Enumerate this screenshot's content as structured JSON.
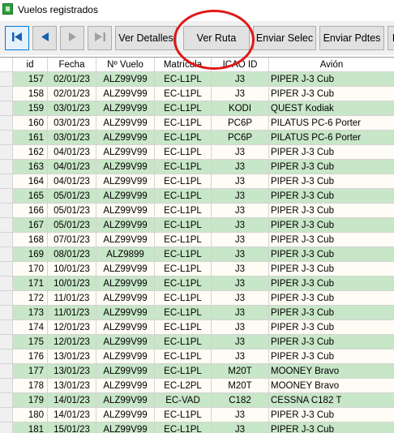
{
  "window": {
    "title": "Vuelos registrados"
  },
  "toolbar": {
    "first_icon": "⏮",
    "prev_icon": "◀",
    "next_icon": "▶",
    "last_icon": "⏭",
    "ver_detalles": "Ver Detalles",
    "ver_ruta": "Ver Ruta",
    "enviar_selec": "Enviar Selec",
    "enviar_pdtes": "Enviar Pdtes",
    "more": "E"
  },
  "colors": {
    "row_green": "#c8e6c8",
    "row_white": "#fefcf4",
    "highlight_circle": "#e01818"
  },
  "table": {
    "headers": [
      "id",
      "Fecha",
      "Nº Vuelo",
      "Matrícula",
      "ICAO ID",
      "Avión"
    ],
    "rows": [
      [
        "157",
        "02/01/23",
        "ALZ99V99",
        "EC-L1PL",
        "J3",
        "PIPER J-3 Cub"
      ],
      [
        "158",
        "02/01/23",
        "ALZ99V99",
        "EC-L1PL",
        "J3",
        "PIPER J-3 Cub"
      ],
      [
        "159",
        "03/01/23",
        "ALZ99V99",
        "EC-L1PL",
        "KODI",
        "QUEST Kodiak"
      ],
      [
        "160",
        "03/01/23",
        "ALZ99V99",
        "EC-L1PL",
        "PC6P",
        "PILATUS PC-6 Porter"
      ],
      [
        "161",
        "03/01/23",
        "ALZ99V99",
        "EC-L1PL",
        "PC6P",
        "PILATUS PC-6 Porter"
      ],
      [
        "162",
        "04/01/23",
        "ALZ99V99",
        "EC-L1PL",
        "J3",
        "PIPER J-3 Cub"
      ],
      [
        "163",
        "04/01/23",
        "ALZ99V99",
        "EC-L1PL",
        "J3",
        "PIPER J-3 Cub"
      ],
      [
        "164",
        "04/01/23",
        "ALZ99V99",
        "EC-L1PL",
        "J3",
        "PIPER J-3 Cub"
      ],
      [
        "165",
        "05/01/23",
        "ALZ99V99",
        "EC-L1PL",
        "J3",
        "PIPER J-3 Cub"
      ],
      [
        "166",
        "05/01/23",
        "ALZ99V99",
        "EC-L1PL",
        "J3",
        "PIPER J-3 Cub"
      ],
      [
        "167",
        "05/01/23",
        "ALZ99V99",
        "EC-L1PL",
        "J3",
        "PIPER J-3 Cub"
      ],
      [
        "168",
        "07/01/23",
        "ALZ99V99",
        "EC-L1PL",
        "J3",
        "PIPER J-3 Cub"
      ],
      [
        "169",
        "08/01/23",
        "ALZ9899",
        "EC-L1PL",
        "J3",
        "PIPER J-3 Cub"
      ],
      [
        "170",
        "10/01/23",
        "ALZ99V99",
        "EC-L1PL",
        "J3",
        "PIPER J-3 Cub"
      ],
      [
        "171",
        "10/01/23",
        "ALZ99V99",
        "EC-L1PL",
        "J3",
        "PIPER J-3 Cub"
      ],
      [
        "172",
        "11/01/23",
        "ALZ99V99",
        "EC-L1PL",
        "J3",
        "PIPER J-3 Cub"
      ],
      [
        "173",
        "11/01/23",
        "ALZ99V99",
        "EC-L1PL",
        "J3",
        "PIPER J-3 Cub"
      ],
      [
        "174",
        "12/01/23",
        "ALZ99V99",
        "EC-L1PL",
        "J3",
        "PIPER J-3 Cub"
      ],
      [
        "175",
        "12/01/23",
        "ALZ99V99",
        "EC-L1PL",
        "J3",
        "PIPER J-3 Cub"
      ],
      [
        "176",
        "13/01/23",
        "ALZ99V99",
        "EC-L1PL",
        "J3",
        "PIPER J-3 Cub"
      ],
      [
        "177",
        "13/01/23",
        "ALZ99V99",
        "EC-L1PL",
        "M20T",
        "MOONEY Bravo"
      ],
      [
        "178",
        "13/01/23",
        "ALZ99V99",
        "EC-L2PL",
        "M20T",
        "MOONEY Bravo"
      ],
      [
        "179",
        "14/01/23",
        "ALZ99V99",
        "EC-VAD",
        "C182",
        "CESSNA C182 T"
      ],
      [
        "180",
        "14/01/23",
        "ALZ99V99",
        "EC-L1PL",
        "J3",
        "PIPER J-3 Cub"
      ],
      [
        "181",
        "15/01/23",
        "ALZ99V99",
        "EC-L1PL",
        "J3",
        "PIPER J-3 Cub"
      ]
    ]
  }
}
